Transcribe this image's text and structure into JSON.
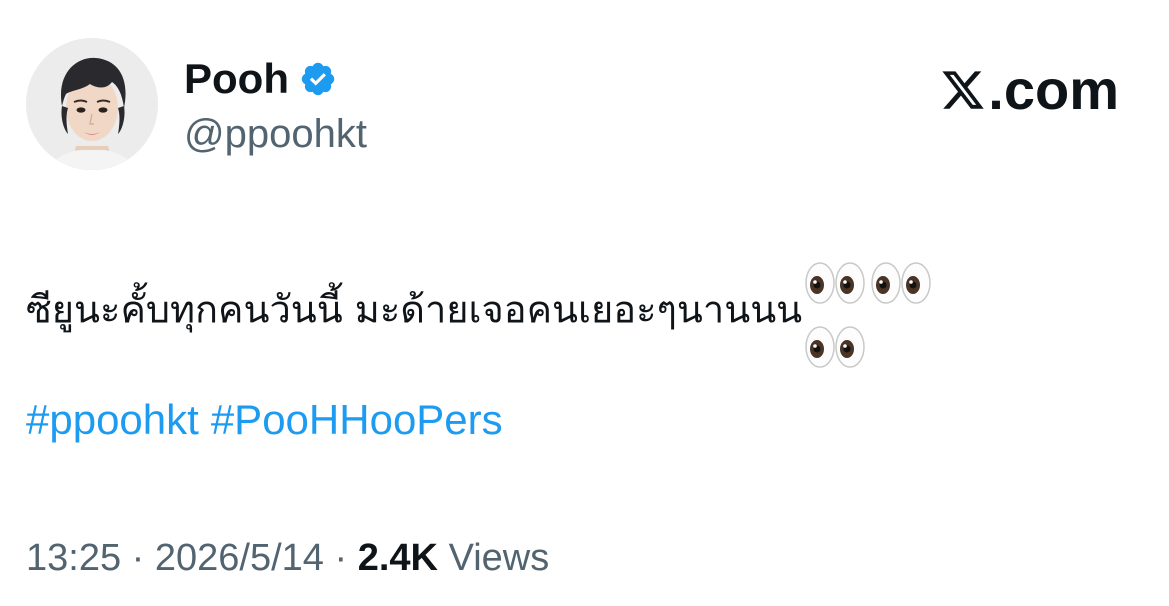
{
  "author": {
    "display_name": "Pooh",
    "handle": "@ppoohkt",
    "verified": true,
    "verified_badge_color": "#1d9bf0"
  },
  "brand": {
    "domain": ".com",
    "logo_icon": "x-logo-icon"
  },
  "tweet": {
    "text": "ซียูนะคั้บทุกคนวันนี้ มะด้ายเจอคนเยอะๆนานนน",
    "emoji_pairs_line1": 2,
    "emoji_pairs_line2": 1,
    "emoji": "👀",
    "hashtags": [
      "#ppoohkt",
      "#PooHHooPers"
    ]
  },
  "meta": {
    "time": "13:25",
    "separator": "·",
    "date": "2026/5/14",
    "views_count": "2.4K",
    "views_label": "Views"
  },
  "colors": {
    "text_primary": "#0f1419",
    "text_secondary": "#536471",
    "link": "#1d9bf0"
  }
}
